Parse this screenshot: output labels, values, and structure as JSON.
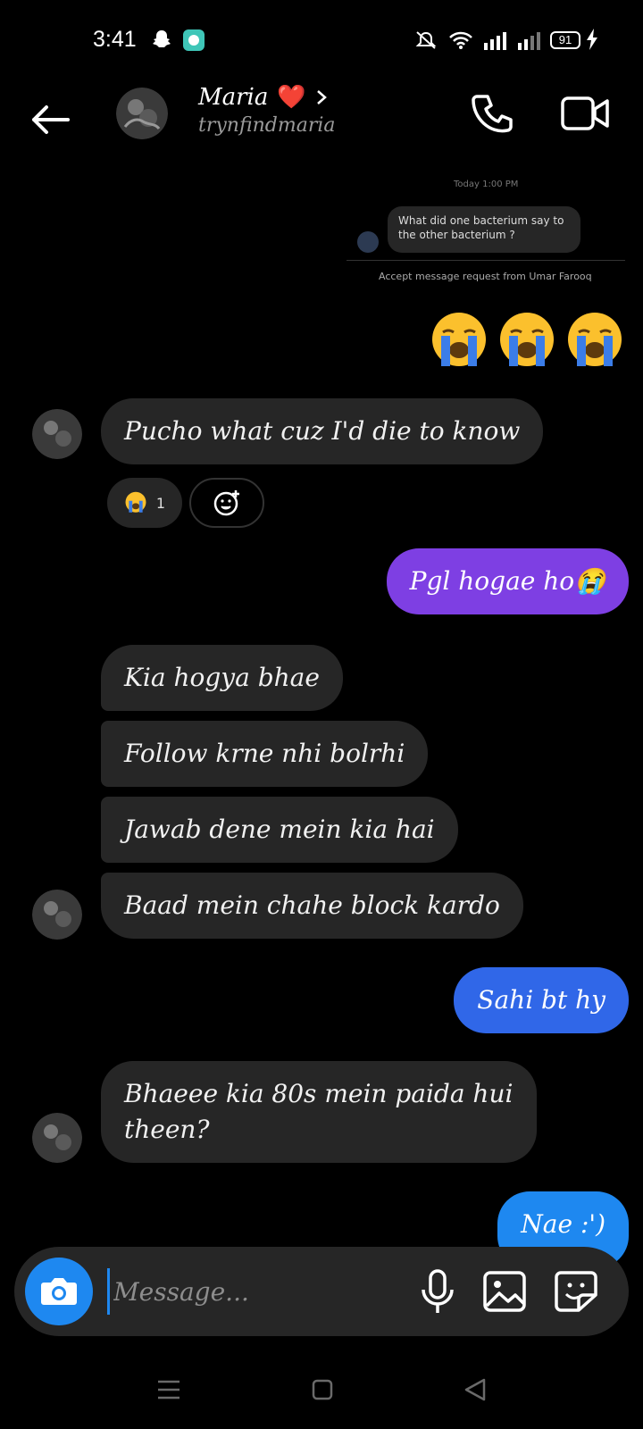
{
  "status_bar": {
    "time": "3:41",
    "battery": "91"
  },
  "header": {
    "contact_name": "Maria",
    "contact_heart": "❤️",
    "username": "trynfindmaria"
  },
  "reply_preview": {
    "timestamp": "Today 1:00 PM",
    "text": "What did one bacterium say to the other bacterium ?",
    "accept_text": "Accept message request from Umar Farooq"
  },
  "messages": [
    {
      "id": "m1",
      "direction": "outgoing",
      "text": "😭😭😭",
      "style": "emoji-large"
    },
    {
      "id": "m2",
      "direction": "incoming",
      "text": "Pucho what cuz I'd die to know",
      "reaction": {
        "emoji": "😭",
        "count": "1"
      }
    },
    {
      "id": "m3",
      "direction": "outgoing",
      "text": "Pgl hogae ho😭",
      "color": "#7e3fe3"
    },
    {
      "id": "m4",
      "direction": "incoming",
      "text": "Kia hogya bhae"
    },
    {
      "id": "m5",
      "direction": "incoming",
      "text": "Follow krne nhi bolrhi"
    },
    {
      "id": "m6",
      "direction": "incoming",
      "text": "Jawab dene mein kia hai"
    },
    {
      "id": "m7",
      "direction": "incoming",
      "text": "Baad mein chahe block kardo"
    },
    {
      "id": "m8",
      "direction": "outgoing",
      "text": "Sahi bt hy",
      "color": "#3067e8"
    },
    {
      "id": "m9",
      "direction": "incoming",
      "text_line1": "Bhaeee kia 80s mein paida hui",
      "text_line2": "theen?"
    },
    {
      "id": "m10",
      "direction": "outgoing",
      "text": "Nae :')",
      "color": "#1e88f0"
    }
  ],
  "composer": {
    "placeholder": "Message..."
  },
  "colors": {
    "accent_blue": "#1e88f0",
    "purple_bubble": "#7e3fe3",
    "blue_bubble": "#3067e8",
    "incoming_bubble": "#262626"
  }
}
